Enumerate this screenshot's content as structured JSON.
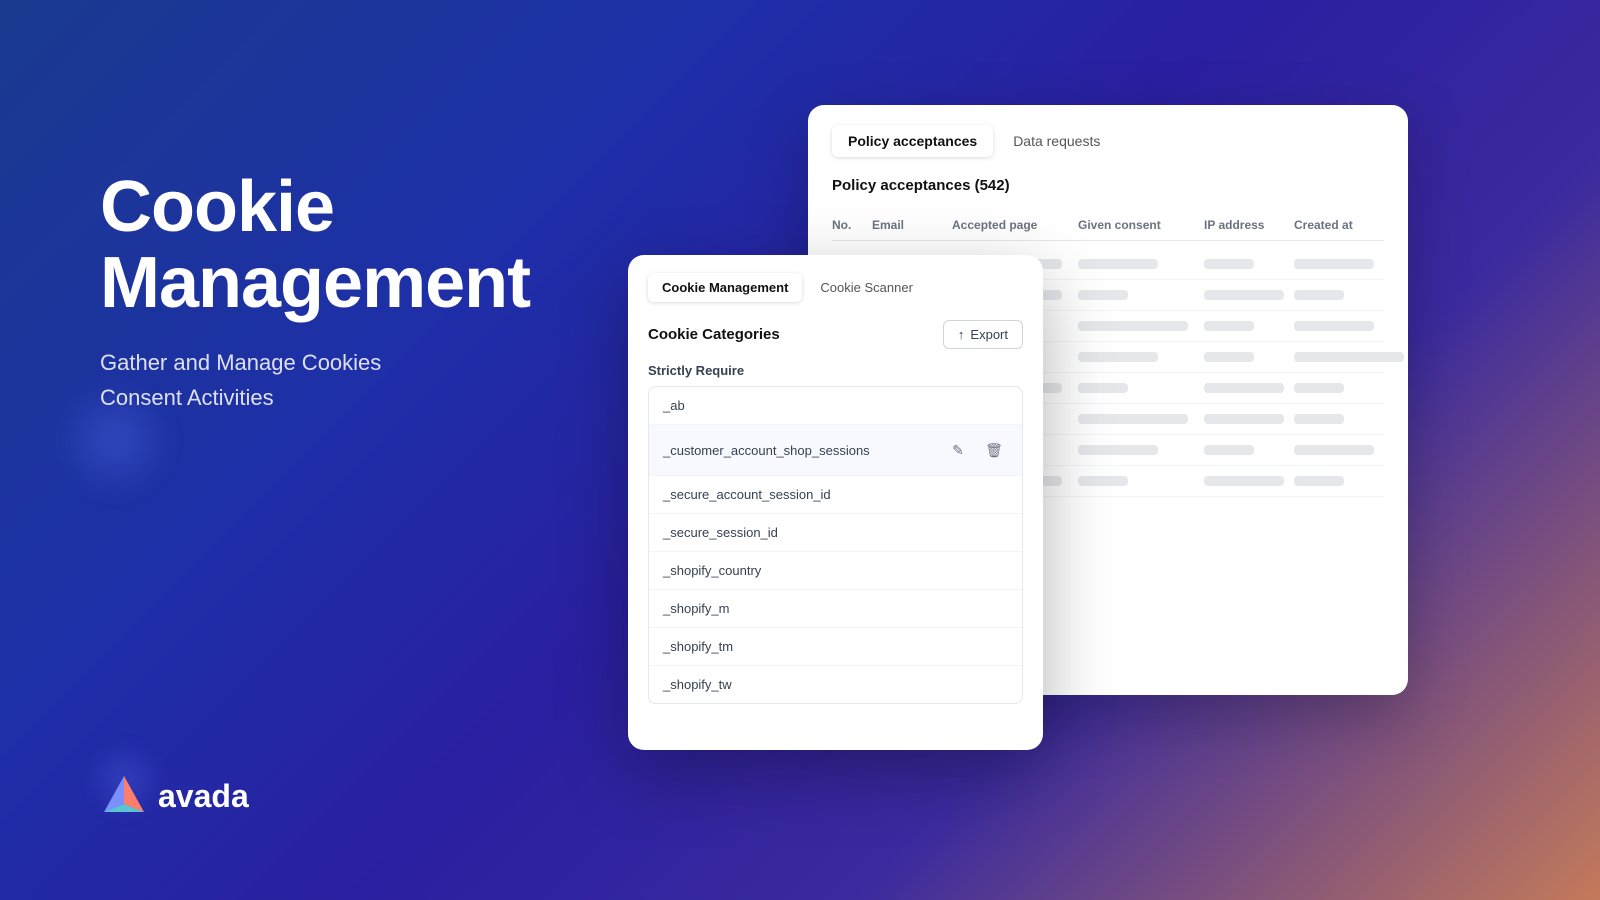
{
  "background": {
    "gradient_start": "#1a3a8f",
    "gradient_end": "#c47a5a"
  },
  "left_panel": {
    "title_line1": "Cookie",
    "title_line2": "Management",
    "subtitle_line1": "Gather and Manage Cookies",
    "subtitle_line2": "Consent Activities"
  },
  "logo": {
    "text": "avada"
  },
  "back_panel": {
    "tab1_label": "Policy acceptances",
    "tab2_label": "Data requests",
    "heading": "Policy acceptances (542)",
    "columns": {
      "no": "No.",
      "email": "Email",
      "accepted_page": "Accepted page",
      "given_consent": "Given consent",
      "ip_address": "IP address",
      "created_at": "Created at"
    }
  },
  "front_panel": {
    "tab1_label": "Cookie Management",
    "tab2_label": "Cookie Scanner",
    "section_title": "Cookie Categories",
    "export_button": "Export",
    "strictly_require_label": "Strictly Require",
    "cookies": [
      {
        "name": "_ab"
      },
      {
        "name": "_customer_account_shop_sessions",
        "highlighted": true
      },
      {
        "name": "_secure_account_session_id"
      },
      {
        "name": "_secure_session_id"
      },
      {
        "name": "_shopify_country"
      },
      {
        "name": "_shopify_m"
      },
      {
        "name": "_shopify_tm"
      },
      {
        "name": "_shopify_tw"
      }
    ]
  }
}
